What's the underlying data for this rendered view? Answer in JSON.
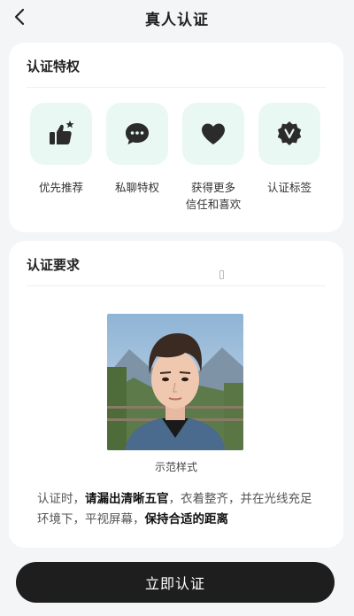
{
  "header": {
    "title": "真人认证"
  },
  "privileges": {
    "title": "认证特权",
    "items": [
      {
        "label": "优先推荐",
        "icon": "thumbs-up-star-icon"
      },
      {
        "label": "私聊特权",
        "icon": "chat-bubble-icon"
      },
      {
        "label": "获得更多\n信任和喜欢",
        "icon": "heart-icon"
      },
      {
        "label": "认证标签",
        "icon": "v-badge-icon"
      }
    ]
  },
  "requirements": {
    "title": "认证要求",
    "sample_caption": "示范样式",
    "text_parts": [
      "认证时，",
      "请漏出清晰五官",
      "，衣着整齐，并在光线充足环境下，平视屏幕，",
      "保持合适的距离"
    ]
  },
  "cta": {
    "label": "立即认证"
  },
  "colors": {
    "accent_bg": "#e9f8f3",
    "icon_dark": "#2b2b2b",
    "button": "#1e1e1e"
  }
}
